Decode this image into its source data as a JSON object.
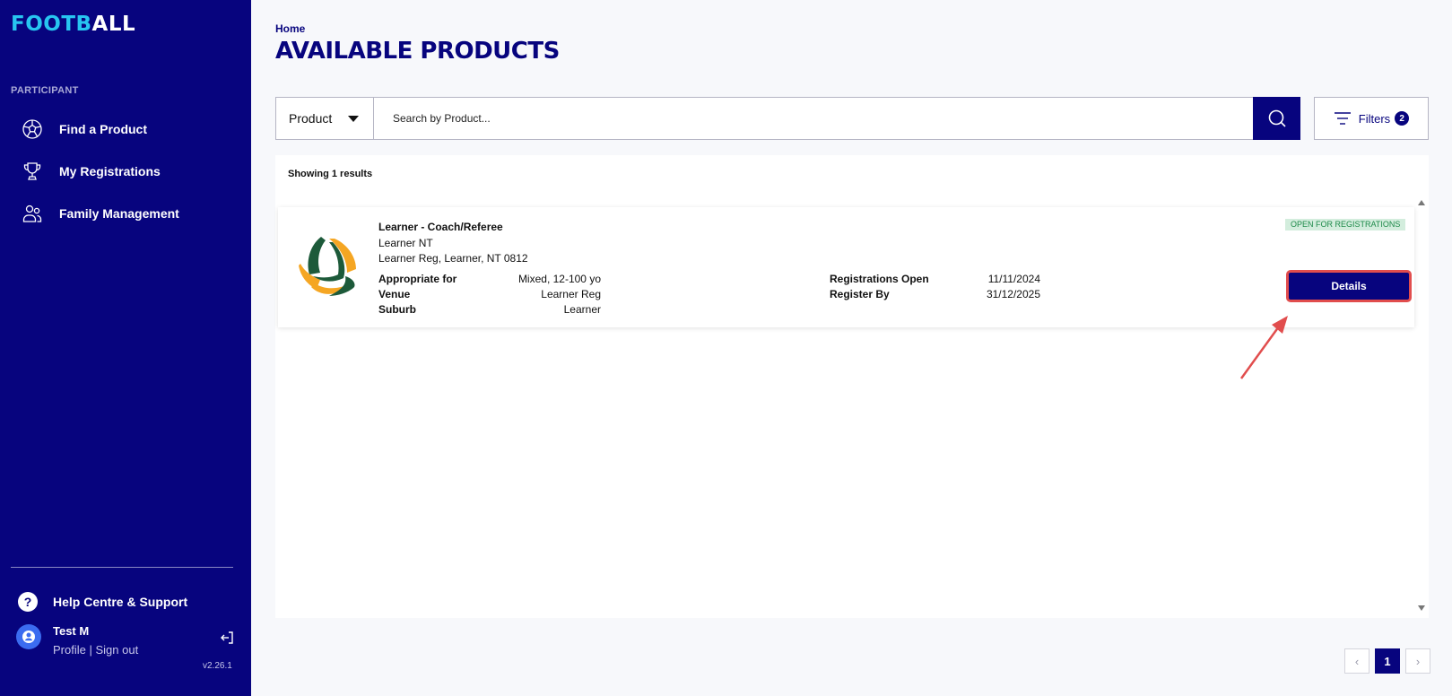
{
  "sidebar": {
    "logo_part1": "FOOTB",
    "logo_part2": "ALL",
    "section_label": "PARTICIPANT",
    "items": [
      {
        "label": "Find a Product",
        "icon": "football-icon"
      },
      {
        "label": "My Registrations",
        "icon": "trophy-icon"
      },
      {
        "label": "Family Management",
        "icon": "people-icon"
      }
    ],
    "help_label": "Help Centre & Support",
    "user": {
      "name": "Test M",
      "profile_link": "Profile",
      "separator": "|",
      "signout_link": "Sign out"
    },
    "version": "v2.26.1"
  },
  "breadcrumb": "Home",
  "page_title": "AVAILABLE PRODUCTS",
  "search": {
    "select_value": "Product",
    "placeholder": "Search by Product...",
    "value": ""
  },
  "filters": {
    "label": "Filters",
    "count": "2"
  },
  "results": {
    "count_text": "Showing 1 results",
    "items": [
      {
        "title": "Learner - Coach/Referee",
        "subtitle": "Learner NT",
        "address": "Learner Reg, Learner, NT 0812",
        "status": "OPEN FOR REGISTRATIONS",
        "fields_left": [
          {
            "label": "Appropriate for",
            "value": "Mixed, 12-100 yo"
          },
          {
            "label": "Venue",
            "value": "Learner Reg"
          },
          {
            "label": "Suburb",
            "value": "Learner"
          }
        ],
        "fields_right": [
          {
            "label": "Registrations Open",
            "value": "11/11/2024"
          },
          {
            "label": "Register By",
            "value": "31/12/2025"
          }
        ],
        "details_label": "Details"
      }
    ]
  },
  "pagination": {
    "prev": "‹",
    "current": "1",
    "next": "›"
  },
  "colors": {
    "brand_navy": "#07047e",
    "logo_accent": "#27c5f0",
    "status_green": "#1e8a4a",
    "highlight_red": "#e14d4d"
  }
}
